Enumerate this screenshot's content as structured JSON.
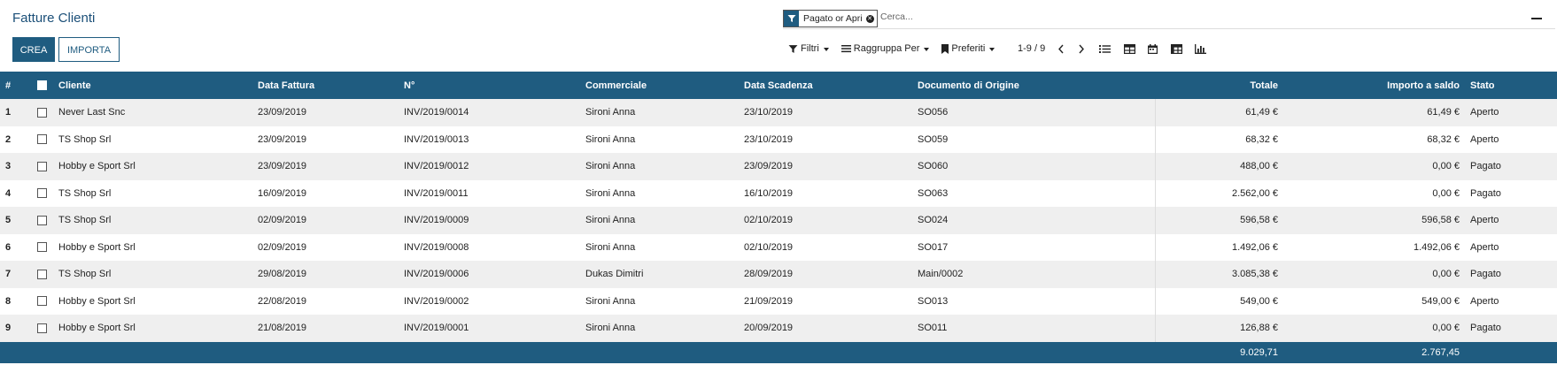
{
  "page_title": "Fatture Clienti",
  "buttons": {
    "create": "CREA",
    "import": "IMPORTA"
  },
  "search": {
    "facet_label": "Pagato or Apri",
    "placeholder": "Cerca..."
  },
  "toolbar": {
    "filters": "Filtri",
    "group_by": "Raggruppa Per",
    "favorites": "Preferiti",
    "pager": "1-9 / 9"
  },
  "table": {
    "headers": {
      "num": "#",
      "customer": "Cliente",
      "invoice_date": "Data Fattura",
      "number": "N°",
      "salesperson": "Commerciale",
      "due_date": "Data Scadenza",
      "origin": "Documento di Origine",
      "total": "Totale",
      "amount_due": "Importo a saldo",
      "status": "Stato"
    },
    "rows": [
      {
        "n": "1",
        "customer": "Never Last Snc",
        "date": "23/09/2019",
        "number": "INV/2019/0014",
        "salesperson": "Sironi Anna",
        "due": "23/10/2019",
        "origin": "SO056",
        "total": "61,49 €",
        "due_amount": "61,49 €",
        "status": "Aperto"
      },
      {
        "n": "2",
        "customer": "TS Shop Srl",
        "date": "23/09/2019",
        "number": "INV/2019/0013",
        "salesperson": "Sironi Anna",
        "due": "23/10/2019",
        "origin": "SO059",
        "total": "68,32 €",
        "due_amount": "68,32 €",
        "status": "Aperto"
      },
      {
        "n": "3",
        "customer": "Hobby e Sport Srl",
        "date": "23/09/2019",
        "number": "INV/2019/0012",
        "salesperson": "Sironi Anna",
        "due": "23/09/2019",
        "origin": "SO060",
        "total": "488,00 €",
        "due_amount": "0,00 €",
        "status": "Pagato"
      },
      {
        "n": "4",
        "customer": "TS Shop Srl",
        "date": "16/09/2019",
        "number": "INV/2019/0011",
        "salesperson": "Sironi Anna",
        "due": "16/10/2019",
        "origin": "SO063",
        "total": "2.562,00 €",
        "due_amount": "0,00 €",
        "status": "Pagato"
      },
      {
        "n": "5",
        "customer": "TS Shop Srl",
        "date": "02/09/2019",
        "number": "INV/2019/0009",
        "salesperson": "Sironi Anna",
        "due": "02/10/2019",
        "origin": "SO024",
        "total": "596,58 €",
        "due_amount": "596,58 €",
        "status": "Aperto"
      },
      {
        "n": "6",
        "customer": "Hobby e Sport Srl",
        "date": "02/09/2019",
        "number": "INV/2019/0008",
        "salesperson": "Sironi Anna",
        "due": "02/10/2019",
        "origin": "SO017",
        "total": "1.492,06 €",
        "due_amount": "1.492,06 €",
        "status": "Aperto"
      },
      {
        "n": "7",
        "customer": "TS Shop Srl",
        "date": "29/08/2019",
        "number": "INV/2019/0006",
        "salesperson": "Dukas Dimitri",
        "due": "28/09/2019",
        "origin": "Main/0002",
        "total": "3.085,38 €",
        "due_amount": "0,00 €",
        "status": "Pagato"
      },
      {
        "n": "8",
        "customer": "Hobby e Sport Srl",
        "date": "22/08/2019",
        "number": "INV/2019/0002",
        "salesperson": "Sironi Anna",
        "due": "21/09/2019",
        "origin": "SO013",
        "total": "549,00 €",
        "due_amount": "549,00 €",
        "status": "Aperto"
      },
      {
        "n": "9",
        "customer": "Hobby e Sport Srl",
        "date": "21/08/2019",
        "number": "INV/2019/0001",
        "salesperson": "Sironi Anna",
        "due": "20/09/2019",
        "origin": "SO011",
        "total": "126,88 €",
        "due_amount": "0,00 €",
        "status": "Pagato"
      }
    ],
    "footer": {
      "total_sum": "9.029,71",
      "due_sum": "2.767,45"
    }
  },
  "colors": {
    "header_bg": "#1f5c80",
    "title": "#1b4f78",
    "row_alt": "#efefef"
  }
}
